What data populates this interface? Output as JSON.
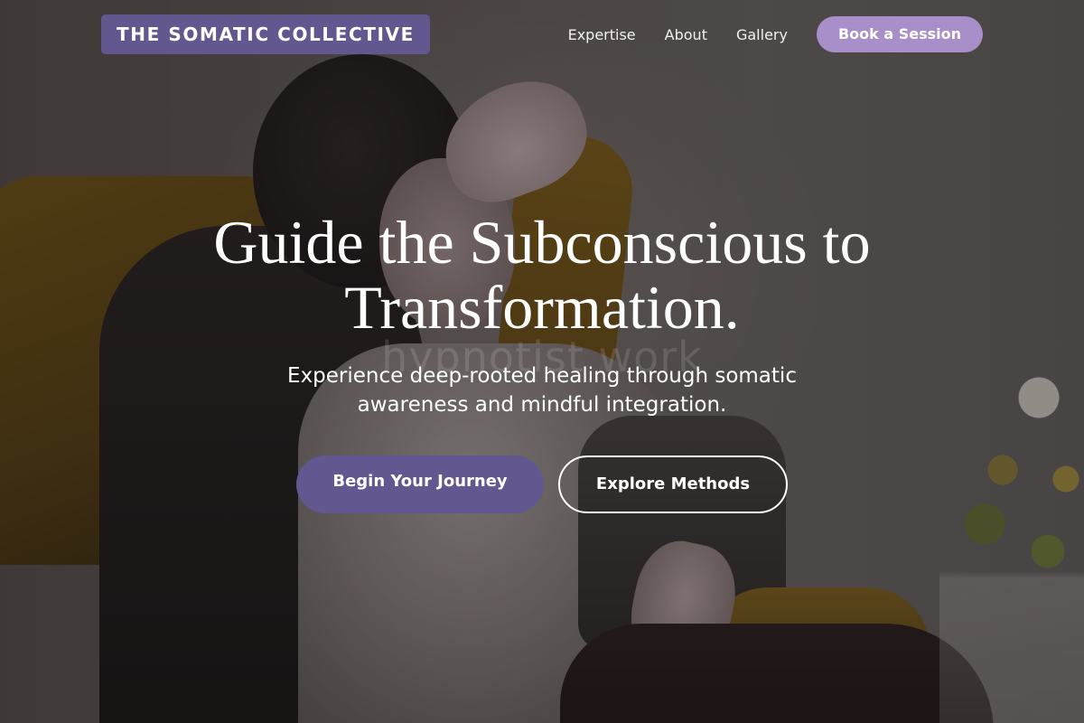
{
  "nav": {
    "brand": "THE SOMATIC COLLECTIVE",
    "links": [
      {
        "label": "Expertise"
      },
      {
        "label": "About"
      },
      {
        "label": "Gallery"
      }
    ],
    "cta_label": "Book a Session"
  },
  "hero": {
    "background_image_text": "hypnotist work",
    "headline": "Guide the Subconscious to Transformation.",
    "subtext": "Experience deep-rooted healing through somatic awareness and mindful integration.",
    "primary_button": "Begin Your Journey",
    "secondary_button": "Explore Methods"
  },
  "colors": {
    "brand_purple": "#63578f",
    "cta_lavender": "#a98fc9",
    "text": "#ffffff"
  }
}
